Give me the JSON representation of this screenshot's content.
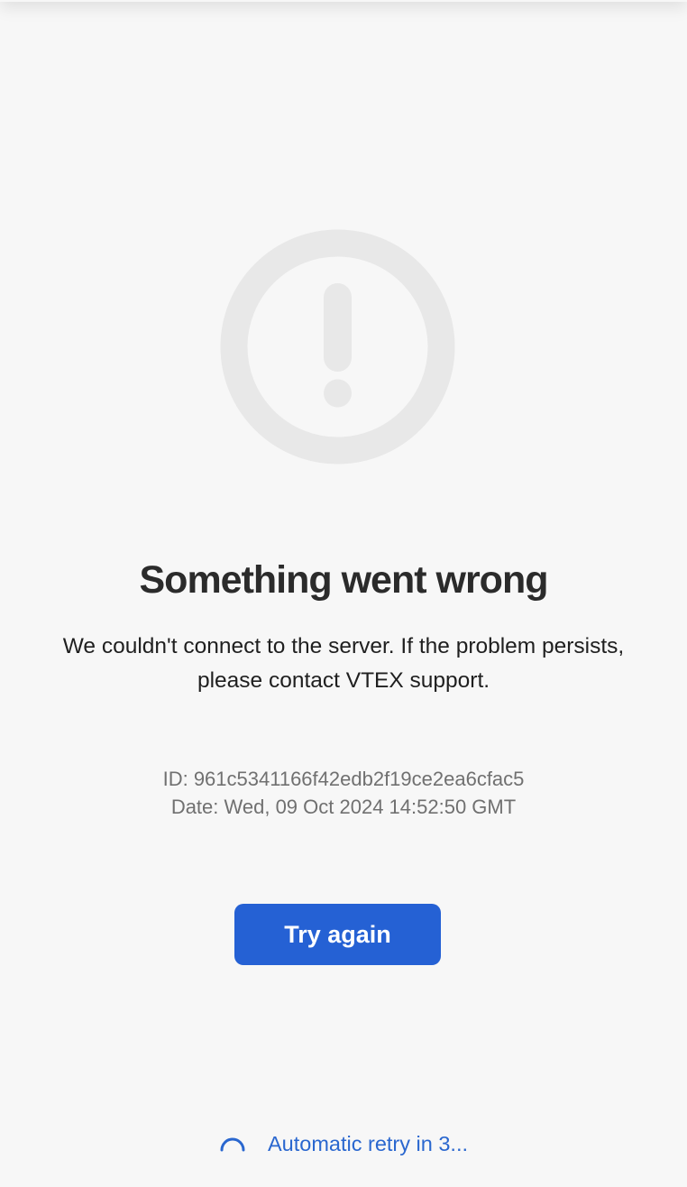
{
  "error": {
    "icon": "exclamation-circle-icon",
    "title": "Something went wrong",
    "message_line1": "We couldn't connect to the server. If the problem persists,",
    "message_line2": "please contact VTEX support.",
    "id_line": "ID: 961c5341166f42edb2f19ce2ea6cfac5",
    "date_line": "Date: Wed, 09 Oct 2024 14:52:50 GMT"
  },
  "actions": {
    "try_again_label": "Try again"
  },
  "retry": {
    "icon": "loading-spinner-icon",
    "text": "Automatic retry in 3..."
  },
  "colors": {
    "background": "#f7f7f7",
    "icon_gray": "#e8e8e8",
    "accent": "#2561d4",
    "link_blue": "#2a67cf"
  }
}
